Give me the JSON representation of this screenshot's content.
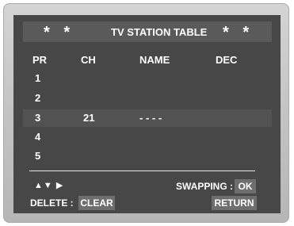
{
  "header": {
    "stars_left": "* *",
    "title": "TV STATION TABLE",
    "stars_right": "* *"
  },
  "columns": [
    "PR",
    "CH",
    "NAME",
    "DEC"
  ],
  "rows": [
    {
      "pr": "1",
      "ch": "",
      "name": "",
      "dec": ""
    },
    {
      "pr": "2",
      "ch": "",
      "name": "",
      "dec": ""
    },
    {
      "pr": "3",
      "ch": "21",
      "name": "- - - -",
      "dec": "",
      "selected": true
    },
    {
      "pr": "4",
      "ch": "",
      "name": "",
      "dec": ""
    },
    {
      "pr": "5",
      "ch": "",
      "name": "",
      "dec": ""
    }
  ],
  "footer": {
    "nav_arrows": "▲▼ ▶",
    "swapping_label": "SWAPPING :",
    "ok_key": "OK",
    "delete_label": "DELETE :",
    "clear_key": "CLEAR",
    "return_key": "RETURN"
  },
  "colors": {
    "screen_background": "#474747",
    "highlight_row": "#525252",
    "key_background": "#6e6e6e",
    "text": "#ffffff",
    "bezel": "#c6c6c6"
  }
}
